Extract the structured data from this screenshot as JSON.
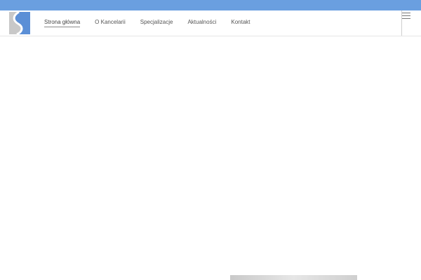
{
  "nav": {
    "items": [
      {
        "label": "Strona główna",
        "active": true
      },
      {
        "label": "O Kancelarii",
        "active": false
      },
      {
        "label": "Specjalizacje",
        "active": false
      },
      {
        "label": "Aktualności",
        "active": false
      },
      {
        "label": "Kontakt",
        "active": false
      }
    ]
  },
  "icons": {
    "logo": "s-logo-icon",
    "menu": "hamburger-menu-icon"
  },
  "colors": {
    "top_strip": "#6a9fe0",
    "logo_blue": "#5b8fd6",
    "logo_gray": "#c8c8c8",
    "nav_text": "#555555"
  }
}
